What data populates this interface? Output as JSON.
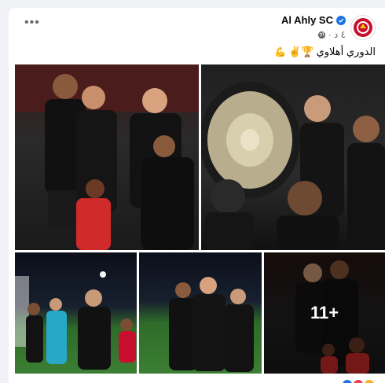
{
  "post": {
    "page_name": "Al Ahly SC",
    "time": "٤ د",
    "caption_text": "الدوري أهلاوي",
    "caption_emojis": "🏆✌️",
    "more_photos_label": "11+"
  },
  "colors": {
    "verified": "#1b74e4",
    "brand_red": "#c8102e"
  },
  "icons": [
    "verified-badge-icon",
    "globe-icon",
    "more-options-icon"
  ]
}
